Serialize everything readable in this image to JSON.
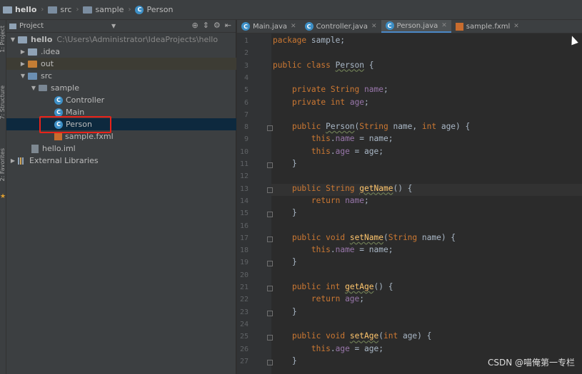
{
  "breadcrumb": [
    {
      "label": "hello",
      "icon": "folder-icon",
      "bold": true
    },
    {
      "label": "src",
      "icon": "folder-icon"
    },
    {
      "label": "sample",
      "icon": "folder-icon"
    },
    {
      "label": "Person",
      "icon": "class-icon"
    }
  ],
  "left_strip": {
    "project_label": "1: Project",
    "structure_label": "7: Structure",
    "favorites_label": "2: Favorites"
  },
  "project_panel": {
    "title": "Project",
    "tree": [
      {
        "label": "hello",
        "path": "C:\\Users\\Administrator\\IdeaProjects\\hello",
        "icon": "module-folder-icon"
      },
      {
        "label": ".idea",
        "icon": "folder-icon"
      },
      {
        "label": "out",
        "icon": "folder-orange-icon"
      },
      {
        "label": "src",
        "icon": "folder-blue-icon"
      },
      {
        "label": "sample",
        "icon": "package-icon"
      },
      {
        "label": "Controller",
        "icon": "class-icon"
      },
      {
        "label": "Main",
        "icon": "class-icon"
      },
      {
        "label": "Person",
        "icon": "class-icon"
      },
      {
        "label": "sample.fxml",
        "icon": "fxml-icon"
      },
      {
        "label": "hello.iml",
        "icon": "file-icon"
      },
      {
        "label": "External Libraries",
        "icon": "library-icon"
      }
    ]
  },
  "tabs": [
    {
      "label": "Main.java"
    },
    {
      "label": "Controller.java"
    },
    {
      "label": "Person.java",
      "active": true
    },
    {
      "label": "sample.fxml"
    }
  ],
  "code_lines": [
    "package sample;",
    "",
    "public class Person {",
    "",
    "    private String name;",
    "    private int age;",
    "",
    "    public Person(String name, int age) {",
    "        this.name = name;",
    "        this.age = age;",
    "    }",
    "",
    "    public String getName() {",
    "        return name;",
    "    }",
    "",
    "    public void setName(String name) {",
    "        this.name = name;",
    "    }",
    "",
    "    public int getAge() {",
    "        return age;",
    "    }",
    "",
    "    public void setAge(int age) {",
    "        this.age = age;",
    "    }"
  ],
  "line_numbers": [
    "1",
    "2",
    "3",
    "4",
    "5",
    "6",
    "7",
    "8",
    "9",
    "10",
    "11",
    "12",
    "13",
    "14",
    "15",
    "16",
    "17",
    "18",
    "19",
    "20",
    "21",
    "22",
    "23",
    "24",
    "25",
    "26",
    "27"
  ],
  "watermark": "CSDN @喵俺第一专栏",
  "colors": {
    "keyword": "#cc7832",
    "field": "#9876aa",
    "function": "#ffc66d",
    "text": "#a9b7c6",
    "selection": "#0d293e",
    "highlight_box": "#e8231a"
  }
}
